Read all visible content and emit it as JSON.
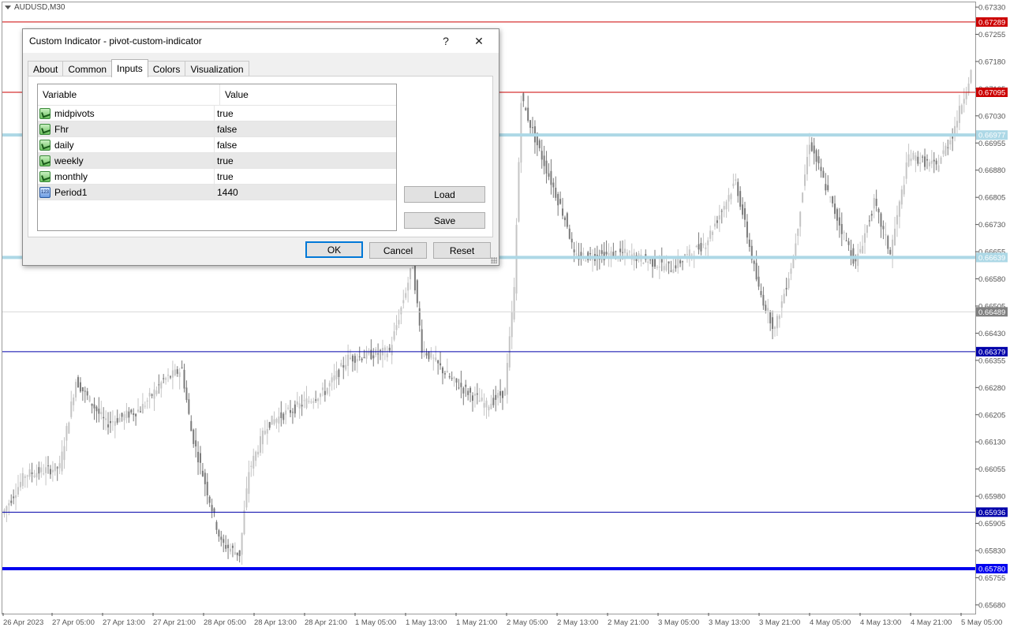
{
  "chart": {
    "symbol": "AUDUSD,M30",
    "price_ticks": [
      "0.67330",
      "0.67255",
      "0.67180",
      "0.67105",
      "0.67030",
      "0.66955",
      "0.66880",
      "0.66805",
      "0.66730",
      "0.66655",
      "0.66580",
      "0.66505",
      "0.66430",
      "0.66355",
      "0.66280",
      "0.66205",
      "0.66130",
      "0.66055",
      "0.65980",
      "0.65905",
      "0.65830",
      "0.65755",
      "0.65680"
    ],
    "time_labels": [
      "26 Apr 2023",
      "27 Apr 05:00",
      "27 Apr 13:00",
      "27 Apr 21:00",
      "28 Apr 05:00",
      "28 Apr 13:00",
      "28 Apr 21:00",
      "1 May 05:00",
      "1 May 13:00",
      "1 May 21:00",
      "2 May 05:00",
      "2 May 13:00",
      "2 May 21:00",
      "3 May 05:00",
      "3 May 13:00",
      "3 May 21:00",
      "4 May 05:00",
      "4 May 13:00",
      "4 May 21:00",
      "5 May 05:00"
    ],
    "levels": [
      {
        "price": 0.67289,
        "label": "0.67289",
        "color": "#cc0000",
        "kind": "thin"
      },
      {
        "price": 0.67095,
        "label": "0.67095",
        "color": "#cc0000",
        "kind": "thin"
      },
      {
        "price": 0.66977,
        "label": "0.66977",
        "color": "#add8e6",
        "kind": "thick"
      },
      {
        "price": 0.66639,
        "label": "0.66639",
        "color": "#add8e6",
        "kind": "thick"
      },
      {
        "price": 0.66489,
        "label": "0.66489",
        "color": "#808080",
        "kind": "bid"
      },
      {
        "price": 0.66379,
        "label": "0.66379",
        "color": "#0000aa",
        "kind": "thin"
      },
      {
        "price": 0.65936,
        "label": "0.65936",
        "color": "#0000aa",
        "kind": "thin"
      },
      {
        "price": 0.6578,
        "label": "0.65780",
        "color": "#0000ee",
        "kind": "heavy"
      }
    ],
    "colors": {
      "up_candle": "#c4c4c4",
      "down_candle": "#7a7a7a",
      "background": "#ffffff"
    }
  },
  "dialog": {
    "title": "Custom Indicator - pivot-custom-indicator",
    "help_label": "?",
    "close_label": "✕",
    "tabs": [
      {
        "label": "About",
        "active": false
      },
      {
        "label": "Common",
        "active": false
      },
      {
        "label": "Inputs",
        "active": true
      },
      {
        "label": "Colors",
        "active": false
      },
      {
        "label": "Visualization",
        "active": false
      }
    ],
    "grid": {
      "headers": {
        "variable": "Variable",
        "value": "Value"
      },
      "rows": [
        {
          "variable": "midpivots",
          "value": "true",
          "icon": "bool-icon"
        },
        {
          "variable": "Fhr",
          "value": "false",
          "icon": "bool-icon"
        },
        {
          "variable": "daily",
          "value": "false",
          "icon": "bool-icon"
        },
        {
          "variable": "weekly",
          "value": "true",
          "icon": "bool-icon"
        },
        {
          "variable": "monthly",
          "value": "true",
          "icon": "bool-icon"
        },
        {
          "variable": "Period1",
          "value": "1440",
          "icon": "number-icon",
          "icon_text": "123"
        }
      ]
    },
    "buttons": {
      "load": "Load",
      "save": "Save",
      "ok": "OK",
      "cancel": "Cancel",
      "reset": "Reset"
    }
  }
}
